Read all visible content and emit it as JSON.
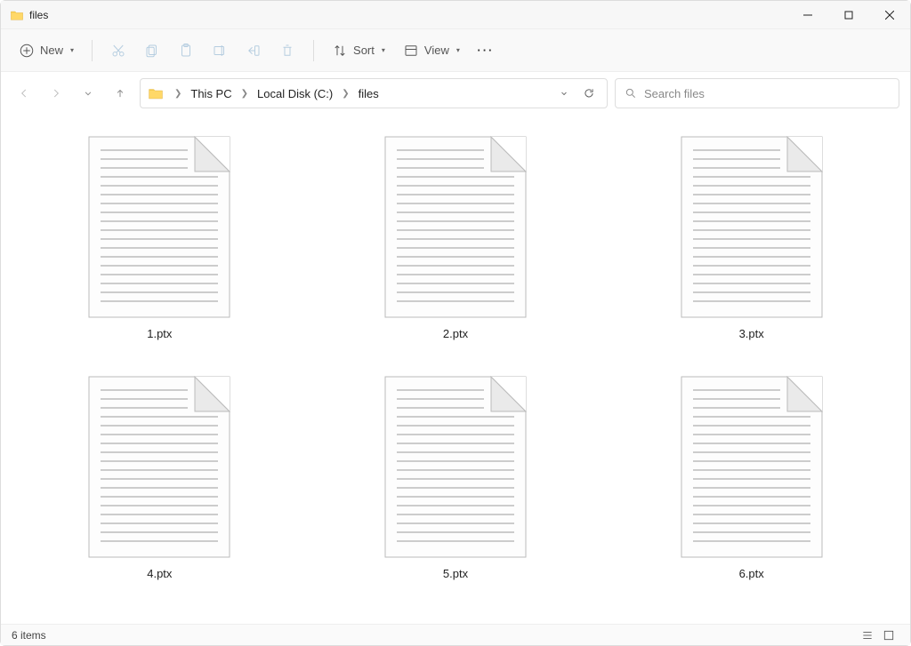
{
  "window": {
    "title": "files"
  },
  "toolbar": {
    "new_label": "New",
    "sort_label": "Sort",
    "view_label": "View"
  },
  "breadcrumbs": {
    "items": [
      {
        "label": "This PC"
      },
      {
        "label": "Local Disk (C:)"
      },
      {
        "label": "files"
      }
    ]
  },
  "search": {
    "placeholder": "Search files"
  },
  "files": [
    {
      "name": "1.ptx"
    },
    {
      "name": "2.ptx"
    },
    {
      "name": "3.ptx"
    },
    {
      "name": "4.ptx"
    },
    {
      "name": "5.ptx"
    },
    {
      "name": "6.ptx"
    }
  ],
  "status": {
    "count_text": "6 items"
  }
}
